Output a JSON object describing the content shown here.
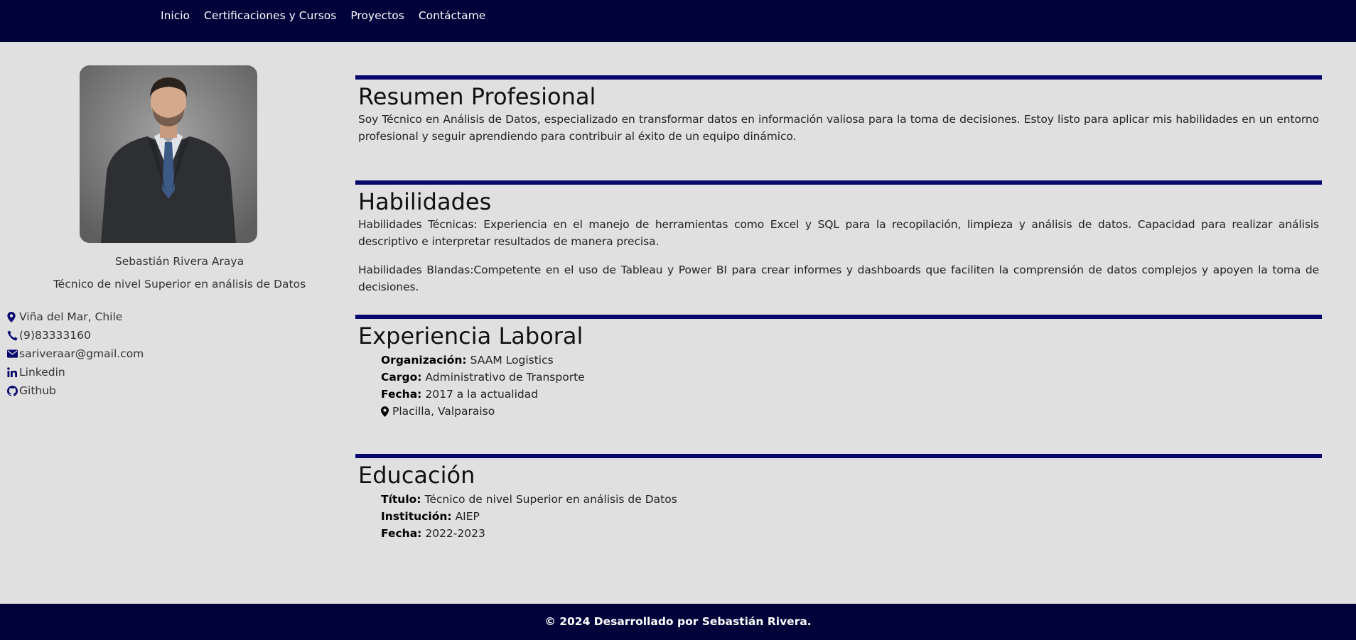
{
  "nav": {
    "items": [
      {
        "label": "Inicio"
      },
      {
        "label": "Certificaciones y Cursos"
      },
      {
        "label": "Proyectos"
      },
      {
        "label": "Contáctame"
      }
    ]
  },
  "profile": {
    "name": "Sebastián Rivera Araya",
    "role": "Técnico de nivel Superior en análisis de Datos",
    "contacts": [
      {
        "icon": "map-marker-icon",
        "label": "Viña del Mar, Chile"
      },
      {
        "icon": "phone-icon",
        "label": "(9)83333160"
      },
      {
        "icon": "envelope-icon",
        "label": "sariveraar@gmail.com"
      },
      {
        "icon": "linkedin-icon",
        "label": "Linkedin"
      },
      {
        "icon": "github-icon",
        "label": "Github"
      }
    ]
  },
  "summary": {
    "title": "Resumen Profesional",
    "text": "Soy Técnico en Análisis de Datos, especializado en transformar datos en información valiosa para la toma de decisiones. Estoy listo para aplicar mis habilidades en un entorno profesional y seguir aprendiendo para contribuir al éxito de un equipo dinámico."
  },
  "skills": {
    "title": "Habilidades",
    "technical": "Habilidades Técnicas: Experiencia en el manejo de herramientas como Excel y SQL para la recopilación, limpieza y análisis de datos. Capacidad para realizar análisis descriptivo e interpretar resultados de manera precisa.",
    "soft": "Habilidades Blandas:Competente en el uso de Tableau y Power BI para crear informes y dashboards que faciliten la comprensión de datos complejos y apoyen la toma de decisiones."
  },
  "experience": {
    "title": "Experiencia Laboral",
    "org_label": "Organización:",
    "org": "SAAM Logistics",
    "position_label": "Cargo:",
    "position": "Administrativo de Transporte",
    "date_label": "Fecha:",
    "date": "2017 a la actualidad",
    "location": "Placilla, Valparaiso"
  },
  "education": {
    "title": "Educación",
    "degree_label": "Título:",
    "degree": "Técnico de nivel Superior en análisis de Datos",
    "institution_label": "Institución:",
    "institution": "AIEP",
    "date_label": "Fecha:",
    "date": "2022-2023"
  },
  "footer": {
    "text": "© 2024 Desarrollado por Sebastián Rivera."
  },
  "colors": {
    "navbar": "#02023a",
    "accent_rule": "#07076e",
    "background": "#e0e0e0",
    "icon": "#07076e"
  }
}
